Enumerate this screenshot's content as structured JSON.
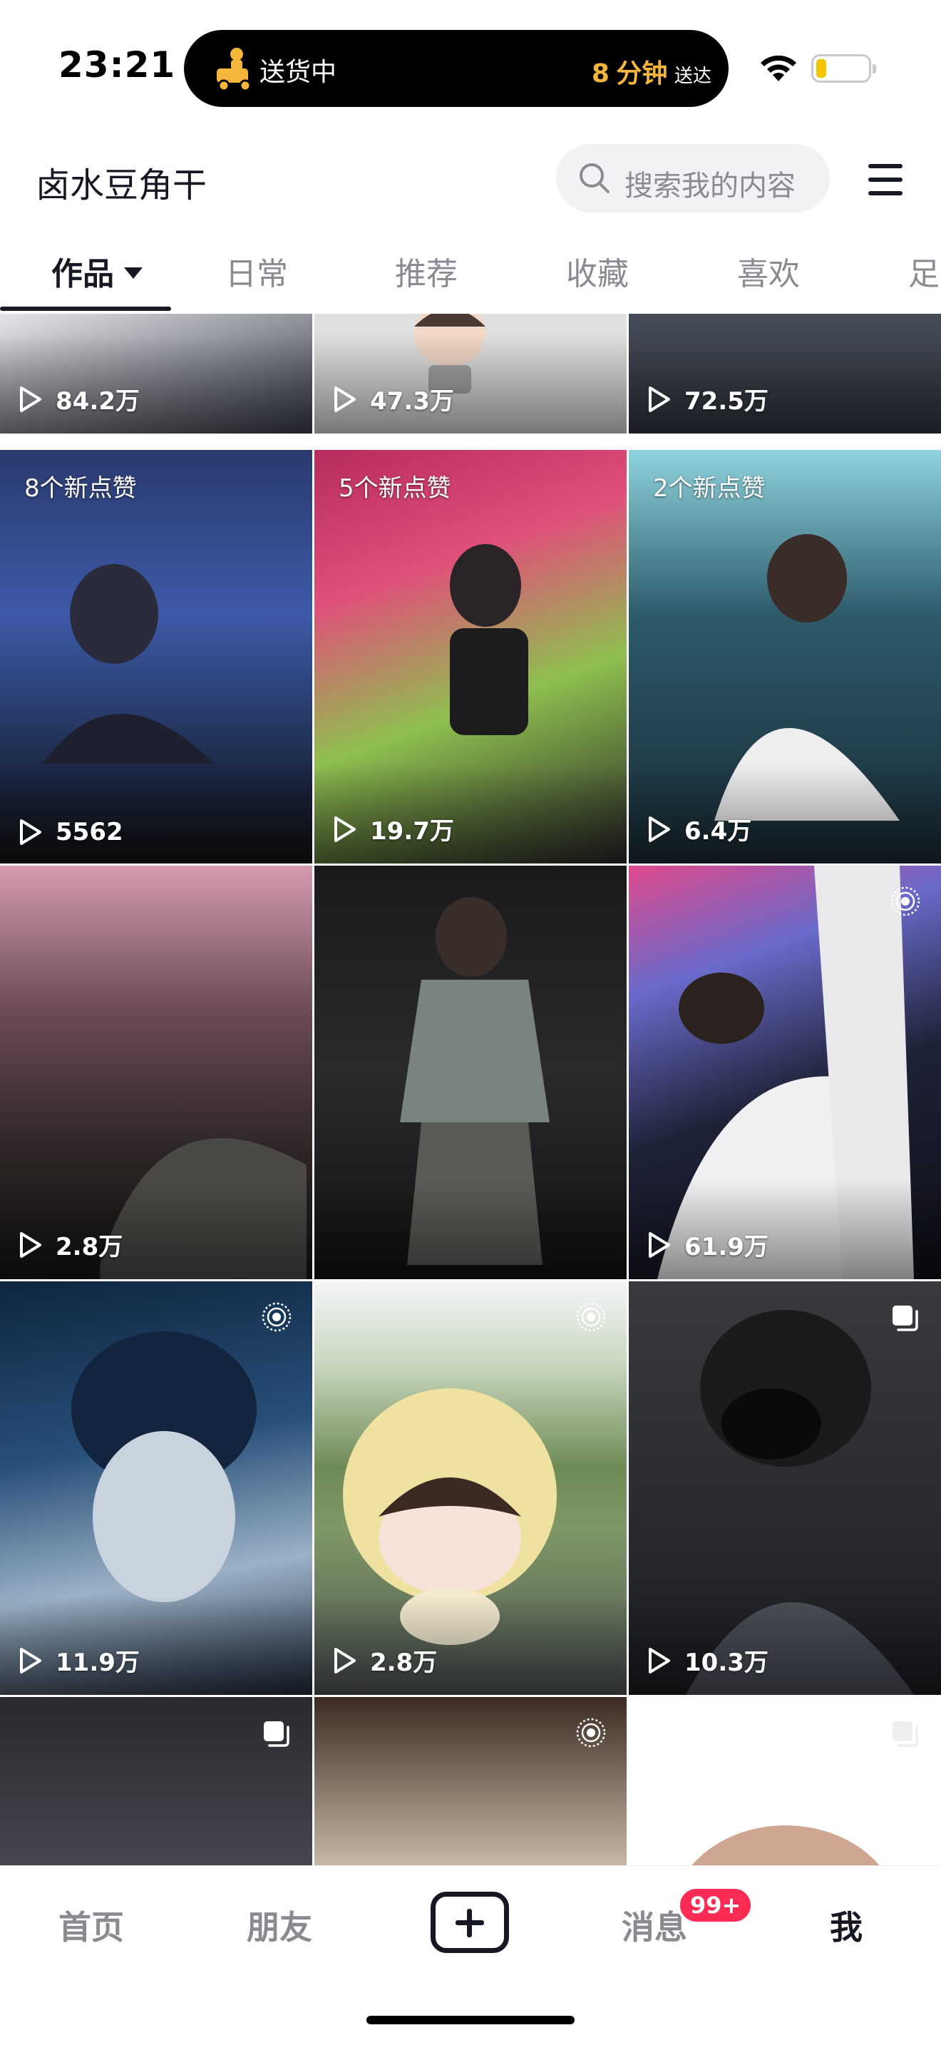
{
  "status_bar": {
    "time": "23:21",
    "delivery_text": "送货中",
    "eta_number": "8",
    "eta_unit": "分钟",
    "eta_suffix": "送达"
  },
  "header": {
    "title": "卤水豆角干",
    "search_placeholder": "搜索我的内容"
  },
  "tabs": [
    {
      "label": "作品",
      "active": true
    },
    {
      "label": "日常"
    },
    {
      "label": "推荐"
    },
    {
      "label": "收藏"
    },
    {
      "label": "喜欢"
    },
    {
      "label": "足"
    }
  ],
  "grid": [
    {
      "plays": "84.2万"
    },
    {
      "plays": "47.3万"
    },
    {
      "plays": "72.5万"
    },
    {
      "badge": "8个新点赞",
      "plays": "5562"
    },
    {
      "badge": "5个新点赞",
      "plays": "19.7万"
    },
    {
      "badge": "2个新点赞",
      "plays": "6.4万"
    },
    {
      "plays": "2.8万"
    },
    {
      "plays": "",
      "caption": ""
    },
    {
      "plays": "61.9万",
      "icon": "live-photo-icon"
    },
    {
      "plays": "11.9万",
      "icon": "live-photo-icon"
    },
    {
      "plays": "2.8万",
      "icon": "live-photo-icon"
    },
    {
      "plays": "10.3万",
      "icon": "multi-image-icon"
    },
    {
      "icon": "multi-image-icon"
    },
    {
      "icon": "live-photo-icon"
    },
    {
      "icon": "multi-image-icon"
    }
  ],
  "bottom_nav": {
    "home": "首页",
    "friends": "朋友",
    "messages": "消息",
    "messages_badge": "99+",
    "me": "我"
  },
  "colors": {
    "accent_red": "#fe2c55",
    "eta_orange": "#f5b73b",
    "text_primary": "#161823",
    "text_secondary": "#8a8b91"
  }
}
